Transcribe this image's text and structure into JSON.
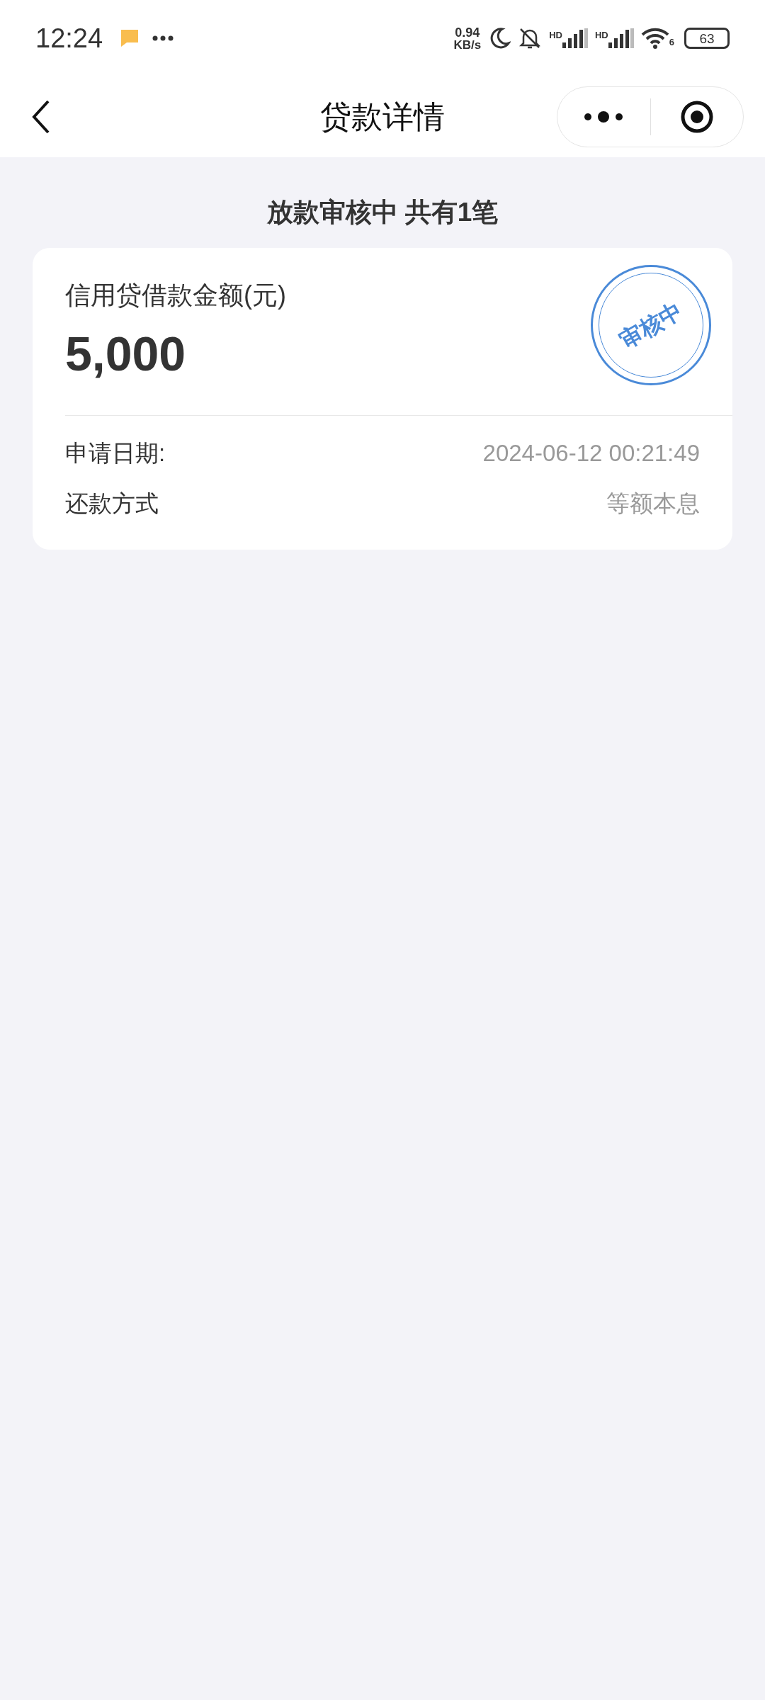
{
  "status_bar": {
    "time": "12:24",
    "speed_value": "0.94",
    "speed_unit": "KB/s",
    "signal_1_label": "HD",
    "signal_2_label": "HD",
    "wifi_label": "6",
    "battery": "63"
  },
  "nav_bar": {
    "title": "贷款详情"
  },
  "summary": "放款审核中 共有1笔",
  "loan_card": {
    "amount_label": "信用贷借款金额(元)",
    "amount": "5,000",
    "stamp": "审核中",
    "rows": [
      {
        "label": "申请日期:",
        "value": "2024-06-12 00:21:49"
      },
      {
        "label": "还款方式",
        "value": "等额本息"
      }
    ]
  }
}
